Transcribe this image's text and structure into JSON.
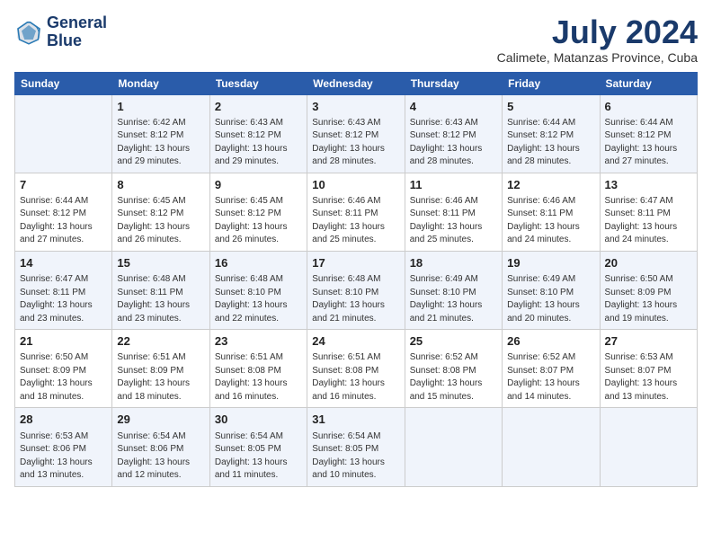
{
  "header": {
    "logo_line1": "General",
    "logo_line2": "Blue",
    "month_year": "July 2024",
    "location": "Calimete, Matanzas Province, Cuba"
  },
  "days_of_week": [
    "Sunday",
    "Monday",
    "Tuesday",
    "Wednesday",
    "Thursday",
    "Friday",
    "Saturday"
  ],
  "weeks": [
    [
      {
        "day": "",
        "info": ""
      },
      {
        "day": "1",
        "info": "Sunrise: 6:42 AM\nSunset: 8:12 PM\nDaylight: 13 hours\nand 29 minutes."
      },
      {
        "day": "2",
        "info": "Sunrise: 6:43 AM\nSunset: 8:12 PM\nDaylight: 13 hours\nand 29 minutes."
      },
      {
        "day": "3",
        "info": "Sunrise: 6:43 AM\nSunset: 8:12 PM\nDaylight: 13 hours\nand 28 minutes."
      },
      {
        "day": "4",
        "info": "Sunrise: 6:43 AM\nSunset: 8:12 PM\nDaylight: 13 hours\nand 28 minutes."
      },
      {
        "day": "5",
        "info": "Sunrise: 6:44 AM\nSunset: 8:12 PM\nDaylight: 13 hours\nand 28 minutes."
      },
      {
        "day": "6",
        "info": "Sunrise: 6:44 AM\nSunset: 8:12 PM\nDaylight: 13 hours\nand 27 minutes."
      }
    ],
    [
      {
        "day": "7",
        "info": "Sunrise: 6:44 AM\nSunset: 8:12 PM\nDaylight: 13 hours\nand 27 minutes."
      },
      {
        "day": "8",
        "info": "Sunrise: 6:45 AM\nSunset: 8:12 PM\nDaylight: 13 hours\nand 26 minutes."
      },
      {
        "day": "9",
        "info": "Sunrise: 6:45 AM\nSunset: 8:12 PM\nDaylight: 13 hours\nand 26 minutes."
      },
      {
        "day": "10",
        "info": "Sunrise: 6:46 AM\nSunset: 8:11 PM\nDaylight: 13 hours\nand 25 minutes."
      },
      {
        "day": "11",
        "info": "Sunrise: 6:46 AM\nSunset: 8:11 PM\nDaylight: 13 hours\nand 25 minutes."
      },
      {
        "day": "12",
        "info": "Sunrise: 6:46 AM\nSunset: 8:11 PM\nDaylight: 13 hours\nand 24 minutes."
      },
      {
        "day": "13",
        "info": "Sunrise: 6:47 AM\nSunset: 8:11 PM\nDaylight: 13 hours\nand 24 minutes."
      }
    ],
    [
      {
        "day": "14",
        "info": "Sunrise: 6:47 AM\nSunset: 8:11 PM\nDaylight: 13 hours\nand 23 minutes."
      },
      {
        "day": "15",
        "info": "Sunrise: 6:48 AM\nSunset: 8:11 PM\nDaylight: 13 hours\nand 23 minutes."
      },
      {
        "day": "16",
        "info": "Sunrise: 6:48 AM\nSunset: 8:10 PM\nDaylight: 13 hours\nand 22 minutes."
      },
      {
        "day": "17",
        "info": "Sunrise: 6:48 AM\nSunset: 8:10 PM\nDaylight: 13 hours\nand 21 minutes."
      },
      {
        "day": "18",
        "info": "Sunrise: 6:49 AM\nSunset: 8:10 PM\nDaylight: 13 hours\nand 21 minutes."
      },
      {
        "day": "19",
        "info": "Sunrise: 6:49 AM\nSunset: 8:10 PM\nDaylight: 13 hours\nand 20 minutes."
      },
      {
        "day": "20",
        "info": "Sunrise: 6:50 AM\nSunset: 8:09 PM\nDaylight: 13 hours\nand 19 minutes."
      }
    ],
    [
      {
        "day": "21",
        "info": "Sunrise: 6:50 AM\nSunset: 8:09 PM\nDaylight: 13 hours\nand 18 minutes."
      },
      {
        "day": "22",
        "info": "Sunrise: 6:51 AM\nSunset: 8:09 PM\nDaylight: 13 hours\nand 18 minutes."
      },
      {
        "day": "23",
        "info": "Sunrise: 6:51 AM\nSunset: 8:08 PM\nDaylight: 13 hours\nand 16 minutes."
      },
      {
        "day": "24",
        "info": "Sunrise: 6:51 AM\nSunset: 8:08 PM\nDaylight: 13 hours\nand 16 minutes."
      },
      {
        "day": "25",
        "info": "Sunrise: 6:52 AM\nSunset: 8:08 PM\nDaylight: 13 hours\nand 15 minutes."
      },
      {
        "day": "26",
        "info": "Sunrise: 6:52 AM\nSunset: 8:07 PM\nDaylight: 13 hours\nand 14 minutes."
      },
      {
        "day": "27",
        "info": "Sunrise: 6:53 AM\nSunset: 8:07 PM\nDaylight: 13 hours\nand 13 minutes."
      }
    ],
    [
      {
        "day": "28",
        "info": "Sunrise: 6:53 AM\nSunset: 8:06 PM\nDaylight: 13 hours\nand 13 minutes."
      },
      {
        "day": "29",
        "info": "Sunrise: 6:54 AM\nSunset: 8:06 PM\nDaylight: 13 hours\nand 12 minutes."
      },
      {
        "day": "30",
        "info": "Sunrise: 6:54 AM\nSunset: 8:05 PM\nDaylight: 13 hours\nand 11 minutes."
      },
      {
        "day": "31",
        "info": "Sunrise: 6:54 AM\nSunset: 8:05 PM\nDaylight: 13 hours\nand 10 minutes."
      },
      {
        "day": "",
        "info": ""
      },
      {
        "day": "",
        "info": ""
      },
      {
        "day": "",
        "info": ""
      }
    ]
  ]
}
